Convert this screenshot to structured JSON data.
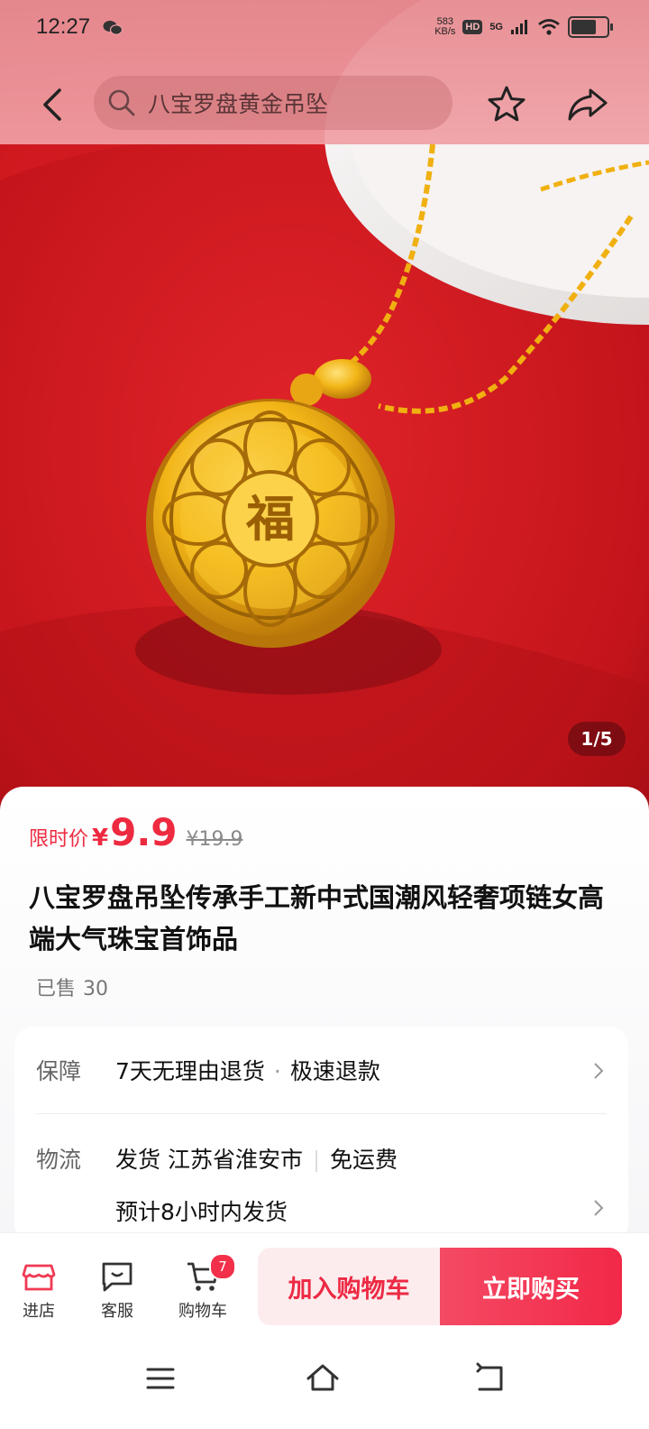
{
  "status_bar": {
    "time": "12:27",
    "net_speed_value": "583",
    "net_speed_unit": "KB/s",
    "hd_badge": "HD",
    "network": "5G",
    "battery_level": 0.8
  },
  "nav": {
    "search_text": "八宝罗盘黄金吊坠"
  },
  "gallery": {
    "counter": "1/5"
  },
  "product": {
    "price_tag": "限时价",
    "currency": "¥",
    "price": "9.9",
    "original_price": "¥19.9",
    "title": "八宝罗盘吊坠传承手工新中式国潮风轻奢项链女高端大气珠宝首饰品",
    "sold_label": "已售",
    "sold_count": "30"
  },
  "services": {
    "guarantee_label": "保障",
    "guarantee_item1": "7天无理由退货",
    "guarantee_item2": "极速退款",
    "logistics_label": "物流",
    "ship_from": "发货 江苏省淮安市",
    "shipping_fee": "免运费",
    "ship_eta": "预计8小时内发货"
  },
  "actions": {
    "store": "进店",
    "service": "客服",
    "cart": "购物车",
    "cart_count": "7",
    "add_to_cart": "加入购物车",
    "buy_now": "立即购买"
  },
  "colors": {
    "accent": "#ee2a40",
    "topbar": "#eb9aa0"
  }
}
